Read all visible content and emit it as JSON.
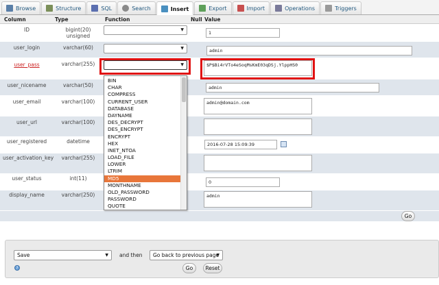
{
  "tabs": [
    {
      "label": "Browse",
      "icon": "browse-icon",
      "color": "#5a7fa8"
    },
    {
      "label": "Structure",
      "icon": "structure-icon",
      "color": "#7b8f59"
    },
    {
      "label": "SQL",
      "icon": "sql-icon",
      "color": "#5b6fb0"
    },
    {
      "label": "Search",
      "icon": "search-icon",
      "color": "#8a8a8a"
    },
    {
      "label": "Insert",
      "icon": "insert-icon",
      "color": "#4a90c0"
    },
    {
      "label": "Export",
      "icon": "export-icon",
      "color": "#5ea05a"
    },
    {
      "label": "Import",
      "icon": "import-icon",
      "color": "#c85050"
    },
    {
      "label": "Operations",
      "icon": "wrench-icon",
      "color": "#7a7a9a"
    },
    {
      "label": "Triggers",
      "icon": "triggers-icon",
      "color": "#9a9a9a"
    }
  ],
  "active_tab": "Insert",
  "columns": {
    "column": "Column",
    "type": "Type",
    "function": "Function",
    "null": "Null",
    "value": "Value"
  },
  "rows": [
    {
      "name": "ID",
      "type": "bigint(20) unsigned",
      "value": "1"
    },
    {
      "name": "user_login",
      "type": "varchar(60)",
      "value": "admin"
    },
    {
      "name": "user_pass",
      "type": "varchar(255)",
      "value": "$P$Bi4rVTo4eSoqMsKmE03qDSj.YlppHS0"
    },
    {
      "name": "user_nicename",
      "type": "varchar(50)",
      "value": "admin"
    },
    {
      "name": "user_email",
      "type": "varchar(100)",
      "value": "admin@domain.com"
    },
    {
      "name": "user_url",
      "type": "varchar(100)",
      "value": ""
    },
    {
      "name": "user_registered",
      "type": "datetime",
      "value": "2016-07-28 15:09:39"
    },
    {
      "name": "user_activation_key",
      "type": "varchar(255)",
      "value": ""
    },
    {
      "name": "user_status",
      "type": "int(11)",
      "value": "0"
    },
    {
      "name": "display_name",
      "type": "varchar(250)",
      "value": "admin"
    }
  ],
  "function_dropdown": {
    "options": [
      "BIN",
      "CHAR",
      "COMPRESS",
      "CURRENT_USER",
      "DATABASE",
      "DAYNAME",
      "DES_DECRYPT",
      "DES_ENCRYPT",
      "ENCRYPT",
      "HEX",
      "INET_NTOA",
      "LOAD_FILE",
      "LOWER",
      "LTRIM",
      "MD5",
      "MONTHNAME",
      "OLD_PASSWORD",
      "PASSWORD",
      "QUOTE"
    ],
    "highlighted": "MD5",
    "highlight_color": "#e8763a"
  },
  "go_label": "Go",
  "bottom": {
    "action_value": "Save",
    "and_then": "and then",
    "after_value": "Go back to previous page",
    "go_label": "Go",
    "reset_label": "Reset"
  }
}
